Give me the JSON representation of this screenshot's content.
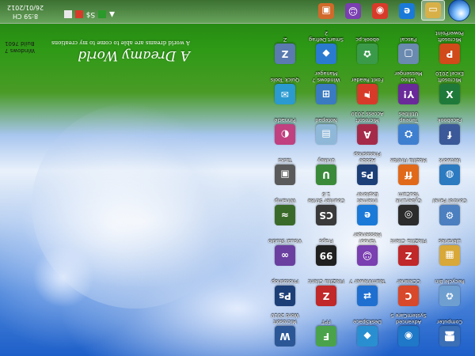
{
  "wallpaper": {
    "title": "A Dreamy World",
    "subtitle": "A world dreams are able to come to my creations"
  },
  "watermark": {
    "line1": "Windows 7",
    "line2": "Build 7601"
  },
  "clock": {
    "time": "8:59 CH",
    "date": "26/01/2012"
  },
  "tray": {
    "chevron": "▲",
    "vol": "S$"
  },
  "desktop_icons": [
    {
      "label": "Computer",
      "icon": "computer-icon",
      "glyph": "🖥",
      "color": "#3b6fb6"
    },
    {
      "label": "Advanced SystemCare 5",
      "icon": "systemcare-icon",
      "glyph": "◉",
      "color": "#1f78c8"
    },
    {
      "label": "DeskSpace",
      "icon": "deskspace-icon",
      "glyph": "◆",
      "color": "#2a8fd0"
    },
    {
      "label": "FPT",
      "icon": "fpt-icon",
      "glyph": "F",
      "color": "#4aa34a"
    },
    {
      "label": "Microsoft Word 2010",
      "icon": "word-icon",
      "glyph": "W",
      "color": "#2b5797"
    },
    {
      "label": "Recycle Bin",
      "icon": "recycle-bin-icon",
      "glyph": "♻",
      "color": "#6f9fd0"
    },
    {
      "label": "CCleaner",
      "icon": "ccleaner-icon",
      "glyph": "C",
      "color": "#d8482a"
    },
    {
      "label": "TeamViewer 7",
      "icon": "teamviewer-icon",
      "glyph": "⇄",
      "color": "#1e6fd0"
    },
    {
      "label": "FileZilla Client",
      "icon": "filezilla-icon",
      "glyph": "Z",
      "color": "#c0282a"
    },
    {
      "label": "Photoshop",
      "icon": "photoshop-icon",
      "glyph": "Ps",
      "color": "#1c3f78"
    },
    {
      "label": "Libraries",
      "icon": "libraries-icon",
      "glyph": "▦",
      "color": "#d8a838"
    },
    {
      "label": "FileZilla Client",
      "icon": "filezilla-icon",
      "glyph": "Z",
      "color": "#c0282a"
    },
    {
      "label": "Yahoo! Messenger",
      "icon": "messenger-icon",
      "glyph": "☺",
      "color": "#7a3fb0"
    },
    {
      "label": "Fraps",
      "icon": "fraps-icon",
      "glyph": "99",
      "color": "#202020"
    },
    {
      "label": "Visual Studio",
      "icon": "visual-studio-icon",
      "glyph": "∞",
      "color": "#6a3fa0"
    },
    {
      "label": "Control Panel",
      "icon": "control-panel-icon",
      "glyph": "⚙",
      "color": "#4b7fbf"
    },
    {
      "label": "CyberLink YouCam",
      "icon": "youcam-icon",
      "glyph": "◎",
      "color": "#2c2c2c"
    },
    {
      "label": "Internet Explorer",
      "icon": "internet-explorer-icon",
      "glyph": "e",
      "color": "#1b7ad8"
    },
    {
      "label": "Counter Strike 1.6",
      "icon": "counter-strike-icon",
      "glyph": "CS",
      "color": "#3a3a3a"
    },
    {
      "label": "Winamp",
      "icon": "winamp-icon",
      "glyph": "≈",
      "color": "#3a6a2a"
    },
    {
      "label": "Network",
      "icon": "network-icon",
      "glyph": "◍",
      "color": "#2c7ac0"
    },
    {
      "label": "Mozilla Firefox",
      "icon": "firefox-icon",
      "glyph": "ff",
      "color": "#e06a1a"
    },
    {
      "label": "Adobe Photoshop",
      "icon": "photoshop-icon",
      "glyph": "Ps",
      "color": "#1c3f78"
    },
    {
      "label": "Unikey",
      "icon": "unikey-icon",
      "glyph": "U",
      "color": "#3a8a3a"
    },
    {
      "label": "Tasks",
      "icon": "tasks-icon",
      "glyph": "▣",
      "color": "#5a5a5a"
    },
    {
      "label": "Facebook",
      "icon": "facebook-icon",
      "glyph": "f",
      "color": "#3b5998"
    },
    {
      "label": "Tuneup Utilities",
      "icon": "tuneup-icon",
      "glyph": "⛭",
      "color": "#3f7fd0"
    },
    {
      "label": "Microsoft Access 2010",
      "icon": "access-icon",
      "glyph": "A",
      "color": "#a52a4a"
    },
    {
      "label": "Notepad",
      "icon": "notepad-icon",
      "glyph": "▤",
      "color": "#8fb8d8"
    },
    {
      "label": "Pinnacle",
      "icon": "pinnacle-icon",
      "glyph": "◐",
      "color": "#c04080"
    },
    {
      "label": "Microsoft Excel 2010",
      "icon": "excel-icon",
      "glyph": "X",
      "color": "#1f7a3a"
    },
    {
      "label": "Yahoo Messenger",
      "icon": "yahoo-icon",
      "glyph": "Y!",
      "color": "#6a2a9a"
    },
    {
      "label": "Foxit Reader",
      "icon": "foxit-icon",
      "glyph": "⚑",
      "color": "#d83a2a"
    },
    {
      "label": "Windows 7 Manager",
      "icon": "windows-manager-icon",
      "glyph": "⊞",
      "color": "#3a7ac0"
    },
    {
      "label": "Quick Tools",
      "icon": "quick-tools-icon",
      "glyph": "✉",
      "color": "#2a9ad0"
    },
    {
      "label": "Microsoft PowerPoint",
      "icon": "powerpoint-icon",
      "glyph": "P",
      "color": "#d04a1a"
    },
    {
      "label": "Pascal",
      "icon": "pascal-icon",
      "glyph": "▢",
      "color": "#6a8ab0"
    },
    {
      "label": "ebook.pc",
      "icon": "ebook-icon",
      "glyph": "✿",
      "color": "#3a9a4a"
    },
    {
      "label": "Smart Defrag 2",
      "icon": "smart-defrag-icon",
      "glyph": "◆",
      "color": "#2a7ad0"
    },
    {
      "label": "Z",
      "icon": "z-icon",
      "glyph": "Z",
      "color": "#5a7ab0"
    }
  ],
  "taskbar_apps": [
    {
      "name": "windows-explorer",
      "icon": "folder-icon",
      "glyph": "▭",
      "color": "#d8b048"
    },
    {
      "name": "internet-explorer",
      "icon": "internet-explorer-icon",
      "glyph": "e",
      "color": "#1b7ad8"
    },
    {
      "name": "chrome",
      "icon": "chrome-icon",
      "glyph": "◉",
      "color": "#d83a2a"
    },
    {
      "name": "messenger",
      "icon": "messenger-icon",
      "glyph": "☺",
      "color": "#7a3fb0"
    },
    {
      "name": "taskbar-app-5",
      "icon": "app-icon",
      "glyph": "▣",
      "color": "#d06a2a"
    }
  ]
}
